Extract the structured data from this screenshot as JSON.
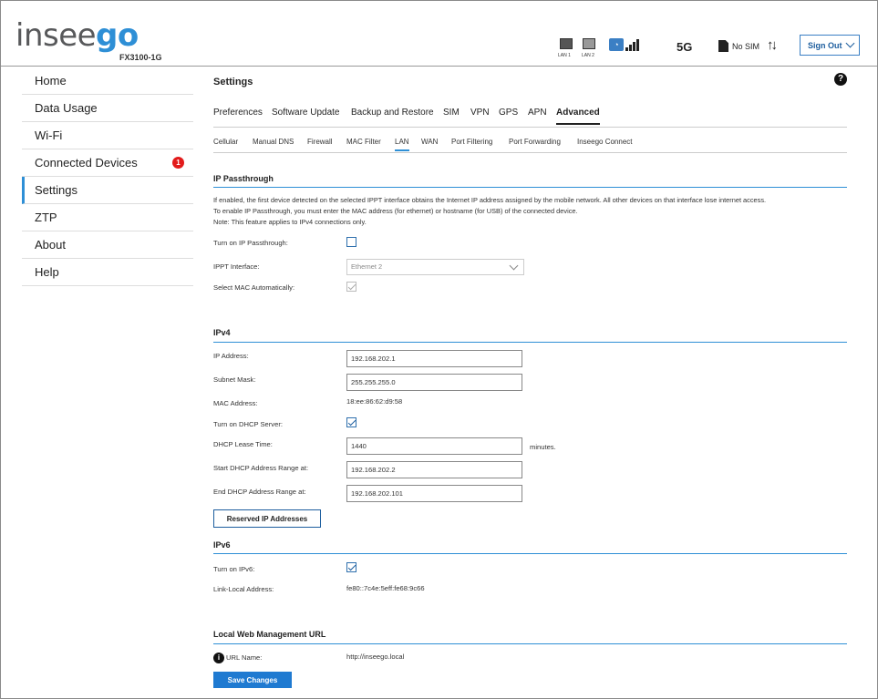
{
  "header": {
    "logo_main": "insee",
    "logo_accent": "go",
    "model": "FX3100-1G",
    "lan1_label": "LAN 1",
    "lan2_label": "LAN 2",
    "network_type": "5G",
    "sim_status": "No SIM",
    "data_arrows": "↑↓",
    "sign_out_label": "Sign Out"
  },
  "sidebar": {
    "items": [
      {
        "label": "Home"
      },
      {
        "label": "Data Usage"
      },
      {
        "label": "Wi-Fi"
      },
      {
        "label": "Connected Devices",
        "badge": "1"
      },
      {
        "label": "Settings",
        "active": true
      },
      {
        "label": "ZTP"
      },
      {
        "label": "About"
      },
      {
        "label": "Help"
      }
    ]
  },
  "page": {
    "title": "Settings",
    "help_glyph": "?"
  },
  "tabs": {
    "primary": [
      "Preferences",
      "Software Update",
      "Backup and Restore",
      "SIM",
      "VPN",
      "GPS",
      "APN",
      "Advanced"
    ],
    "primary_active": "Advanced",
    "secondary": [
      "Cellular",
      "Manual DNS",
      "Firewall",
      "MAC Filter",
      "LAN",
      "WAN",
      "Port Filtering",
      "Port Forwarding",
      "Inseego Connect"
    ],
    "secondary_active": "LAN"
  },
  "ip_passthrough": {
    "title": "IP Passthrough",
    "desc_line1": "If enabled, the first device detected on the selected IPPT interface obtains the Internet IP address assigned by the mobile network. All other devices on that interface lose internet access.",
    "desc_line2": "To enable IP Passthrough, you must enter the MAC address (for ethernet) or hostname (for USB) of the connected device.",
    "desc_line3": "Note: This feature applies to IPv4 connections only.",
    "turn_on_label": "Turn on IP Passthrough:",
    "turn_on_checked": false,
    "interface_label": "IPPT Interface:",
    "interface_value": "Ethernet 2",
    "mac_auto_label": "Select MAC Automatically:",
    "mac_auto_checked": true
  },
  "ipv4": {
    "title": "IPv4",
    "ip_label": "IP Address:",
    "ip_value": "192.168.202.1",
    "subnet_label": "Subnet Mask:",
    "subnet_value": "255.255.255.0",
    "mac_label": "MAC Address:",
    "mac_value": "18:ee:86:62:d9:58",
    "dhcp_label": "Turn on DHCP Server:",
    "dhcp_checked": true,
    "lease_label": "DHCP Lease Time:",
    "lease_value": "1440",
    "lease_unit": "minutes.",
    "start_label": "Start DHCP Address Range at:",
    "start_value": "192.168.202.2",
    "end_label": "End DHCP Address Range at:",
    "end_value": "192.168.202.101",
    "reserved_button": "Reserved IP Addresses"
  },
  "ipv6": {
    "title": "IPv6",
    "turn_on_label": "Turn on IPv6:",
    "turn_on_checked": true,
    "link_local_label": "Link-Local Address:",
    "link_local_value": "fe80::7c4e:5eff:fe68:9c66"
  },
  "web_mgmt": {
    "title": "Local Web Management URL",
    "info_glyph": "i",
    "url_label": "URL Name:",
    "url_value": "http://inseego.local"
  },
  "actions": {
    "save_label": "Save Changes"
  },
  "colors": {
    "accent": "#2e8fd6",
    "button_primary": "#1f7ad1",
    "badge": "#e21b1b"
  }
}
